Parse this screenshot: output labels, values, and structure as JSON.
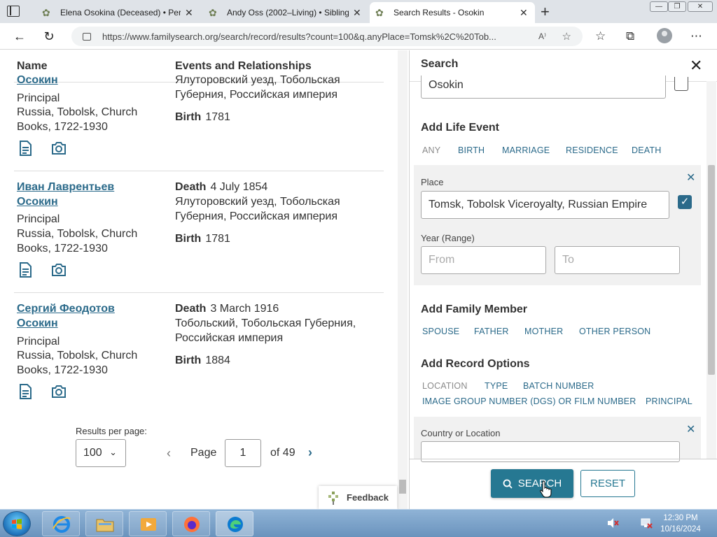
{
  "browser": {
    "tabs": [
      {
        "title": "Elena Osokina (Deceased) • Pers",
        "active": false
      },
      {
        "title": "Andy Oss (2002–Living) • Sibling",
        "active": false
      },
      {
        "title": "Search Results - Osokin",
        "active": true
      }
    ],
    "url": "https://www.familysearch.org/search/record/results?count=100&q.anyPlace=Tomsk%2C%20Tob..."
  },
  "results": {
    "col_name": "Name",
    "col_events": "Events and Relationships",
    "partial_row": {
      "name": "Осокин",
      "role": "Principal",
      "collection": "Russia, Tobolsk, Church Books, 1722-1930",
      "event_place": "Ялуторовский уезд, Тобольская Губерния, Российская империя",
      "birth_label": "Birth",
      "birth_year": "1781"
    },
    "rows": [
      {
        "name": "Иван Лаврентьев Осокин",
        "role": "Principal",
        "collection": "Russia, Tobolsk, Church Books, 1722-1930",
        "death_label": "Death",
        "death_date": "4 July 1854",
        "death_place": "Ялуторовский уезд, Тобольская Губерния, Российская империя",
        "birth_label": "Birth",
        "birth_year": "1781"
      },
      {
        "name": "Сергий Феодотов Осокин",
        "role": "Principal",
        "collection": "Russia, Tobolsk, Church Books, 1722-1930",
        "death_label": "Death",
        "death_date": "3 March 1916",
        "death_place": "Тобольский, Тобольская Губерния, Российская империя",
        "birth_label": "Birth",
        "birth_year": "1884"
      }
    ],
    "results_per_page_label": "Results per page:",
    "results_per_page": "100",
    "page_label": "Page",
    "page_number": "1",
    "page_of": "of 49",
    "feedback": "Feedback"
  },
  "search_panel": {
    "title": "Search",
    "surname_value": "Osokin",
    "life_event_title": "Add Life Event",
    "life_event_tabs": [
      "ANY",
      "BIRTH",
      "MARRIAGE",
      "RESIDENCE",
      "DEATH"
    ],
    "place_label": "Place",
    "place_value": "Tomsk, Tobolsk Viceroyalty, Russian Empire",
    "year_label": "Year (Range)",
    "year_from_placeholder": "From",
    "year_to_placeholder": "To",
    "family_title": "Add Family Member",
    "family_links": [
      "SPOUSE",
      "FATHER",
      "MOTHER",
      "OTHER PERSON"
    ],
    "record_title": "Add Record Options",
    "record_links": [
      "LOCATION",
      "TYPE",
      "BATCH NUMBER",
      "IMAGE GROUP NUMBER (DGS) OR FILM NUMBER",
      "PRINCIPAL"
    ],
    "country_label": "Country or Location",
    "search_button": "SEARCH",
    "reset_button": "RESET"
  },
  "taskbar": {
    "time": "12:30 PM",
    "date": "10/16/2024"
  },
  "colors": {
    "link": "#2b6a8a",
    "search_button": "#267892",
    "panel_gray": "#f1f1f1"
  }
}
